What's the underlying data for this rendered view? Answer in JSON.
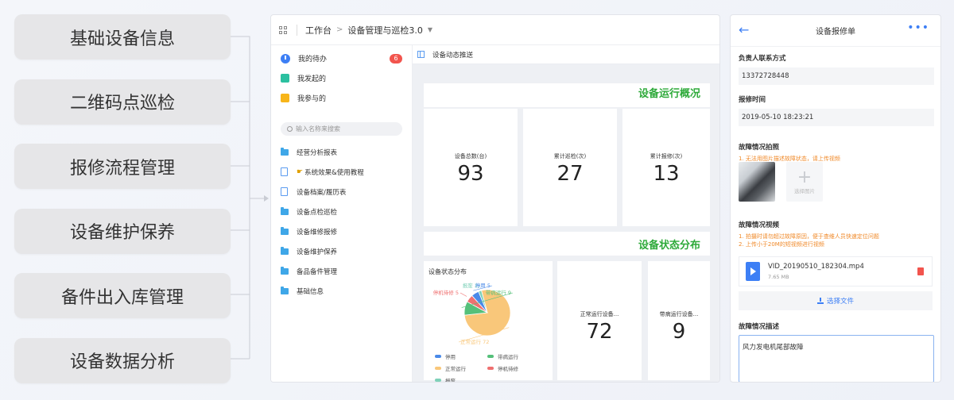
{
  "features": [
    {
      "label": "基础设备信息"
    },
    {
      "label": "二维码点巡检"
    },
    {
      "label": "报修流程管理"
    },
    {
      "label": "设备维护保养"
    },
    {
      "label": "备件出入库管理"
    },
    {
      "label": "设备数据分析"
    }
  ],
  "dashboard": {
    "breadcrumb": {
      "root": "工作台",
      "app": "设备管理与巡检3.0"
    },
    "sidebar": {
      "top_items": [
        {
          "label": "我的待办",
          "badge": "6"
        },
        {
          "label": "我发起的"
        },
        {
          "label": "我参与的"
        }
      ],
      "search_placeholder": "输入名称来搜索",
      "tree": [
        {
          "label": "经营分析报表",
          "icon": "folder-icon"
        },
        {
          "label": "系统效果&使用教程",
          "icon": "doc-icon"
        },
        {
          "label": "设备档案/履历表",
          "icon": "doc-icon"
        },
        {
          "label": "设备点检巡检",
          "icon": "folder-icon"
        },
        {
          "label": "设备维修报修",
          "icon": "folder-icon"
        },
        {
          "label": "设备维护保养",
          "icon": "folder-icon"
        },
        {
          "label": "备品备件管理",
          "icon": "folder-icon"
        },
        {
          "label": "基础信息",
          "icon": "folder-icon"
        }
      ]
    },
    "tab_label": "设备动态推送",
    "section1_title": "设备运行概况",
    "stats": [
      {
        "label": "设备总数(台)",
        "value": "93"
      },
      {
        "label": "累计巡检(次)",
        "value": "27"
      },
      {
        "label": "累计报修(次)",
        "value": "13"
      }
    ],
    "section2_title": "设备状态分布",
    "status_cards": [
      {
        "label": "正常运行设备...",
        "value": "72"
      },
      {
        "label": "带病运行设备...",
        "value": "9"
      }
    ]
  },
  "chart_data": {
    "type": "pie",
    "title": "设备状态分布",
    "slices": [
      {
        "name": "正常运行",
        "value": 72,
        "color": "#f9c77a"
      },
      {
        "name": "带病运行",
        "value": 9,
        "color": "#55c07a"
      },
      {
        "name": "停机待修",
        "value": 5,
        "color": "#ef7070"
      },
      {
        "name": "停用",
        "value": 5,
        "color": "#4a8ae8"
      },
      {
        "name": "报废",
        "value": 2,
        "color": "#7fd1b9"
      }
    ],
    "data_labels": [
      "报废 2",
      "停用 5",
      "带病运行 9",
      "停机待修 5",
      "正常运行 72"
    ],
    "legend": [
      "停用",
      "带病运行",
      "正常运行",
      "停机待修",
      "报废"
    ]
  },
  "mobile": {
    "title": "设备报修单",
    "contact_label": "负责人联系方式",
    "contact_value": "13372728448",
    "time_label": "报修时间",
    "time_value": "2019-05-10 18:23:21",
    "photo_label": "故障情况拍照",
    "photo_hint": "1. 无法用图片描述故障状态，请上传视频",
    "add_photo_label": "选择图片",
    "video_label": "故障情况视频",
    "video_hint_1": "1. 拍摄时请勿超过故障原因，便于查维人员快速定位问题",
    "video_hint_2": "2. 上传小于20M的短视频进行视频",
    "video_name": "VID_20190510_182304.mp4",
    "video_size": "7.65 MB",
    "choose_file_label": "选择文件",
    "desc_label": "故障情况描述",
    "desc_value": "风力发电机尾部故障"
  }
}
